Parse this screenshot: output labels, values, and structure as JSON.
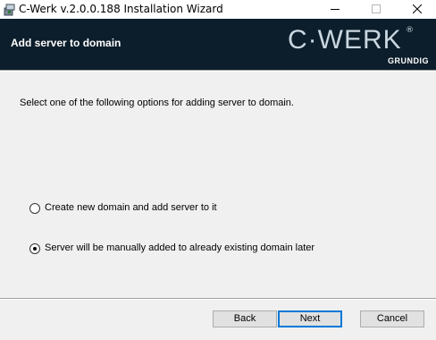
{
  "window": {
    "title": "C-Werk v.2.0.0.188 Installation Wizard",
    "app_icon": "installer-icon"
  },
  "banner": {
    "title": "Add server to domain",
    "logo_main": "C·WERK",
    "logo_reg": "®",
    "logo_sub": "GRUNDIG"
  },
  "content": {
    "instruction": "Select one of the following options for adding server to domain.",
    "options": [
      {
        "label": "Create new domain and add server to it",
        "selected": false
      },
      {
        "label": "Server will be manually added to already existing domain later",
        "selected": true
      }
    ]
  },
  "buttons": {
    "back": "Back",
    "next": "Next",
    "cancel": "Cancel"
  },
  "colors": {
    "banner_bg": "#0c1e2b",
    "focus_accent": "#0078d7"
  }
}
